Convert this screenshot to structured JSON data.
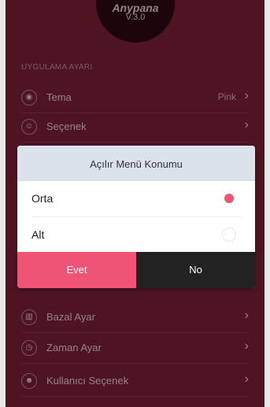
{
  "app": {
    "logo_text": "Anypana",
    "version": "V.3.0"
  },
  "settings": {
    "section_label": "UYGULAMA AYARI",
    "items": [
      {
        "label": "Tema",
        "value": "Pink",
        "icon": "eye-icon"
      },
      {
        "label": "Seçenek",
        "value": "",
        "icon": "users-icon"
      },
      {
        "label": "Bazal Ayar",
        "value": "",
        "icon": "chart-icon"
      },
      {
        "label": "Zaman Ayar",
        "value": "",
        "icon": "clock-icon"
      },
      {
        "label": "Kullanıcı Seçenek",
        "value": "",
        "icon": "user-icon"
      }
    ]
  },
  "dialog": {
    "title": "Açılır Menü Konumu",
    "options": [
      {
        "label": "Orta",
        "selected": true
      },
      {
        "label": "Alt",
        "selected": false
      }
    ],
    "confirm_label": "Evet",
    "cancel_label": "No"
  },
  "colors": {
    "background": "#7a1f35",
    "accent": "#ef5376",
    "dark_button": "#222222",
    "dialog_header": "#dbe2ec"
  }
}
